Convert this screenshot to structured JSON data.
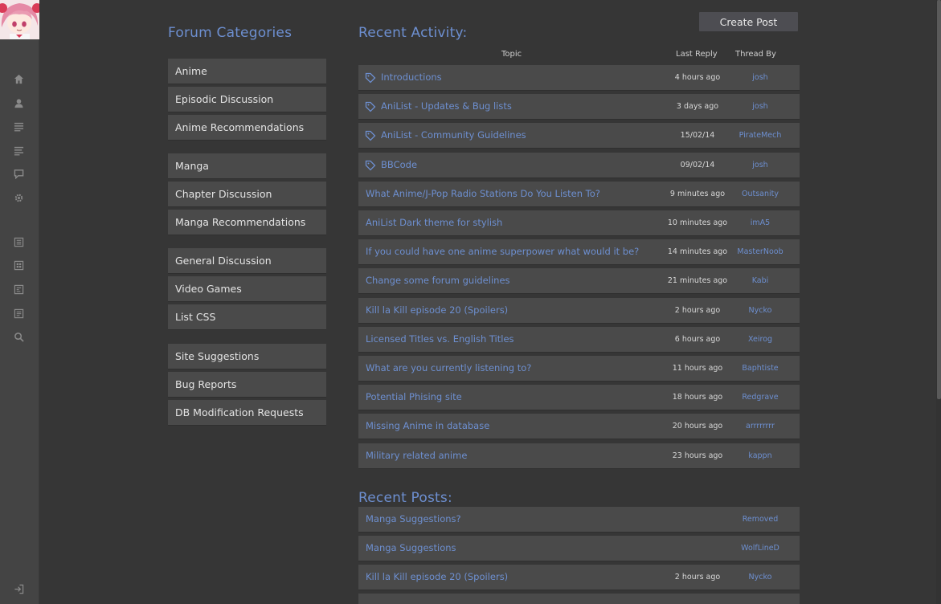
{
  "sidebar": {
    "avatar_alt": "user avatar",
    "icons": [
      "home-icon",
      "profile-icon",
      "list-icon",
      "list-alt-icon",
      "chat-icon",
      "gear-icon",
      "browse-anime-icon",
      "browse-manga-icon",
      "browse-characters-icon",
      "browse-staff-icon",
      "search-icon",
      "logout-icon"
    ]
  },
  "categories_heading": "Forum Categories",
  "categories": [
    {
      "label": "Anime"
    },
    {
      "label": "Episodic Discussion"
    },
    {
      "label": "Anime Recommendations"
    },
    {
      "label": "Manga"
    },
    {
      "label": "Chapter Discussion"
    },
    {
      "label": "Manga Recommendations"
    },
    {
      "label": "General Discussion"
    },
    {
      "label": "Video Games"
    },
    {
      "label": "List CSS"
    },
    {
      "label": "Site Suggestions"
    },
    {
      "label": "Bug Reports"
    },
    {
      "label": "DB Modification Requests"
    }
  ],
  "create_post_label": "Create Post",
  "activity_heading": "Recent Activity:",
  "columns": {
    "topic": "Topic",
    "last_reply": "Last Reply",
    "thread_by": "Thread By"
  },
  "activity": [
    {
      "topic": "Introductions",
      "time": "4 hours ago",
      "by": "josh",
      "pinned": true
    },
    {
      "topic": "AniList - Updates & Bug lists",
      "time": "3 days ago",
      "by": "josh",
      "pinned": true
    },
    {
      "topic": "AniList - Community Guidelines",
      "time": "15/02/14",
      "by": "PirateMech",
      "pinned": true
    },
    {
      "topic": "BBCode",
      "time": "09/02/14",
      "by": "josh",
      "pinned": true
    },
    {
      "topic": "What Anime/J-Pop Radio Stations Do You Listen To?",
      "time": "9 minutes ago",
      "by": "Outsanity",
      "pinned": false
    },
    {
      "topic": "AniList Dark theme for stylish",
      "time": "10 minutes ago",
      "by": "imA5",
      "pinned": false
    },
    {
      "topic": "If you could have one anime superpower what would it be?",
      "time": "14 minutes ago",
      "by": "MasterNoob",
      "pinned": false
    },
    {
      "topic": "Change some forum guidelines",
      "time": "21 minutes ago",
      "by": "Kabi",
      "pinned": false
    },
    {
      "topic": "Kill la Kill episode 20 (Spoilers)",
      "time": "2 hours ago",
      "by": "Nycko",
      "pinned": false
    },
    {
      "topic": "Licensed Titles vs. English Titles",
      "time": "6 hours ago",
      "by": "Xeirog",
      "pinned": false
    },
    {
      "topic": "What are you currently listening to?",
      "time": "11 hours ago",
      "by": "Baphtiste",
      "pinned": false
    },
    {
      "topic": "Potential Phising site",
      "time": "18 hours ago",
      "by": "Redgrave",
      "pinned": false
    },
    {
      "topic": "Missing Anime in database",
      "time": "20 hours ago",
      "by": "arrrrrrrr",
      "pinned": false
    },
    {
      "topic": "Military related anime",
      "time": "23 hours ago",
      "by": "kappn",
      "pinned": false
    }
  ],
  "posts_heading": "Recent Posts:",
  "posts": [
    {
      "topic": "Manga Suggestions?",
      "time": "",
      "by": "Removed"
    },
    {
      "topic": "Manga Suggestions",
      "time": "",
      "by": "WolfLineD"
    },
    {
      "topic": "Kill la Kill episode 20 (Spoilers)",
      "time": "2 hours ago",
      "by": "Nycko"
    },
    {
      "topic": "",
      "time": "",
      "by": ""
    }
  ],
  "colors": {
    "accent": "#6d8fd0",
    "background": "#363636",
    "panel": "#4a4a4a"
  }
}
